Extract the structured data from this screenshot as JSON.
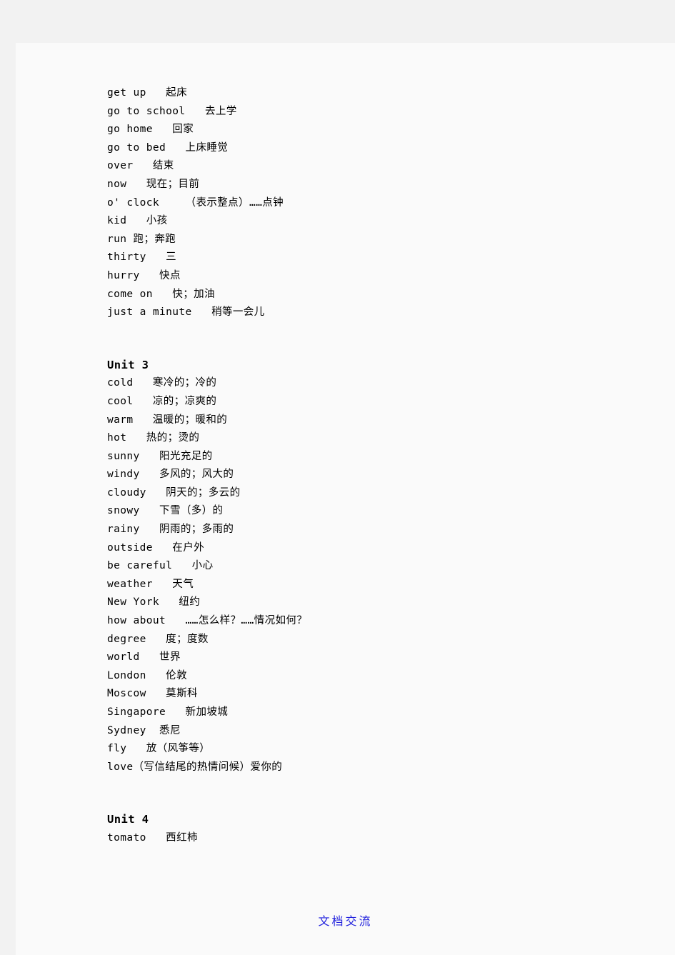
{
  "page": {
    "background_color": "#f2f2f2",
    "sheet_color": "#fafafa",
    "text_color": "#000000",
    "accent_color": "#2222dd"
  },
  "sections": [
    {
      "heading": null,
      "entries": [
        "get up   起床",
        "go to school   去上学",
        "go home   回家",
        "go to bed   上床睡觉",
        "over   结束",
        "now   现在；目前",
        "o' clock    （表示整点）……点钟",
        "kid   小孩",
        "run 跑；奔跑",
        "thirty   三",
        "hurry   快点",
        "come on   快；加油",
        "just a minute   稍等一会儿"
      ]
    },
    {
      "heading": "Unit 3",
      "entries": [
        "cold   寒冷的；冷的",
        "cool   凉的；凉爽的",
        "warm   温暖的；暖和的",
        "hot   热的；烫的",
        "sunny   阳光充足的",
        "windy   多风的；风大的",
        "cloudy   阴天的；多云的",
        "snowy   下雪（多）的",
        "rainy   阴雨的；多雨的",
        "outside   在户外",
        "be careful   小心",
        "weather   天气",
        "New York   纽约",
        "how about   ……怎么样？……情况如何？",
        "degree   度；度数",
        "world   世界",
        "London   伦敦",
        "Moscow   莫斯科",
        "Singapore   新加坡城",
        "Sydney  悉尼",
        "fly   放（风筝等）",
        "love（写信结尾的热情问候）爱你的"
      ]
    },
    {
      "heading": "Unit 4",
      "entries": [
        "tomato   西红柿"
      ]
    }
  ],
  "footer": {
    "watermark": "文档交流"
  }
}
